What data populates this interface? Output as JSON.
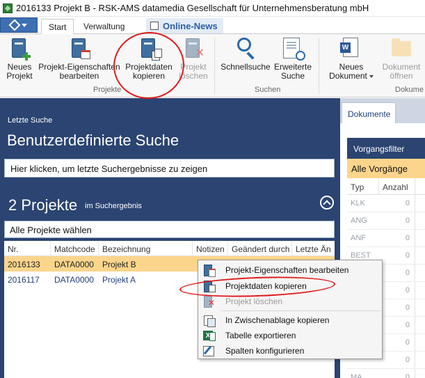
{
  "window": {
    "title": "2016133 Projekt B - RSK-AMS  datamedia Gesellschaft für Unternehmensberatung mbH"
  },
  "ribbon_tabs": {
    "start": "Start",
    "verwaltung": "Verwaltung",
    "online_news": "Online-News"
  },
  "ribbon": {
    "neues_projekt": "Neues Projekt",
    "projekt_eigenschaften": "Projekt-Eigenschaften bearbeiten",
    "projektdaten_kopieren": "Projektdaten kopieren",
    "projekt_loeschen": "Projekt löschen",
    "group_projekte": "Projekte",
    "schnellsuche": "Schnellsuche",
    "erweiterte_suche": "Erweiterte Suche",
    "group_suchen": "Suchen",
    "neues_dokument": "Neues Dokument",
    "dokument_oeffnen": "Dokument öffnen",
    "group_dokumente": "Dokume"
  },
  "search_panel": {
    "caption": "Letzte Suche",
    "title": "Benutzerdefinierte Suche",
    "last_results_hint": "Hier klicken, um letzte Suchergebnisse zu zeigen",
    "result_count": "2 Projekte",
    "result_count_suffix": "im Suchergebnis",
    "select_all": "Alle Projekte wählen"
  },
  "grid": {
    "columns": [
      "Nr.",
      "Matchcode",
      "Bezeichnung",
      "Notizen",
      "Geändert durch",
      "Letzte Än"
    ],
    "rows": [
      {
        "nr": "2016133",
        "matchcode": "DATA0000",
        "bezeichnung": "Projekt B"
      },
      {
        "nr": "2016117",
        "matchcode": "DATA0000",
        "bezeichnung": "Projekt A"
      }
    ]
  },
  "right_panel": {
    "tab": "Dokumente",
    "filter_title": "Vorgangsfilter",
    "filter_selected": "Alle Vorgänge",
    "columns": [
      "Typ",
      "Anzahl"
    ],
    "rows": [
      {
        "typ": "KLK",
        "anzahl": "0"
      },
      {
        "typ": "ANG",
        "anzahl": "0"
      },
      {
        "typ": "ANF",
        "anzahl": "0"
      },
      {
        "typ": "BEST",
        "anzahl": "0"
      },
      {
        "typ": "",
        "anzahl": "0"
      },
      {
        "typ": "",
        "anzahl": "0"
      },
      {
        "typ": "",
        "anzahl": "0"
      },
      {
        "typ": "",
        "anzahl": "0"
      },
      {
        "typ": "",
        "anzahl": "0"
      },
      {
        "typ": "",
        "anzahl": "0"
      },
      {
        "typ": "MA",
        "anzahl": "0"
      }
    ]
  },
  "context_menu": {
    "items": [
      "Projekt-Eigenschaften bearbeiten",
      "Projektdaten kopieren",
      "Projekt löschen",
      "In Zwischenablage kopieren",
      "Tabelle exportieren",
      "Spalten konfigurieren"
    ]
  },
  "colors": {
    "accent_dark": "#2b4471",
    "selection": "#fbd58b",
    "annotation": "#e01b1b"
  }
}
